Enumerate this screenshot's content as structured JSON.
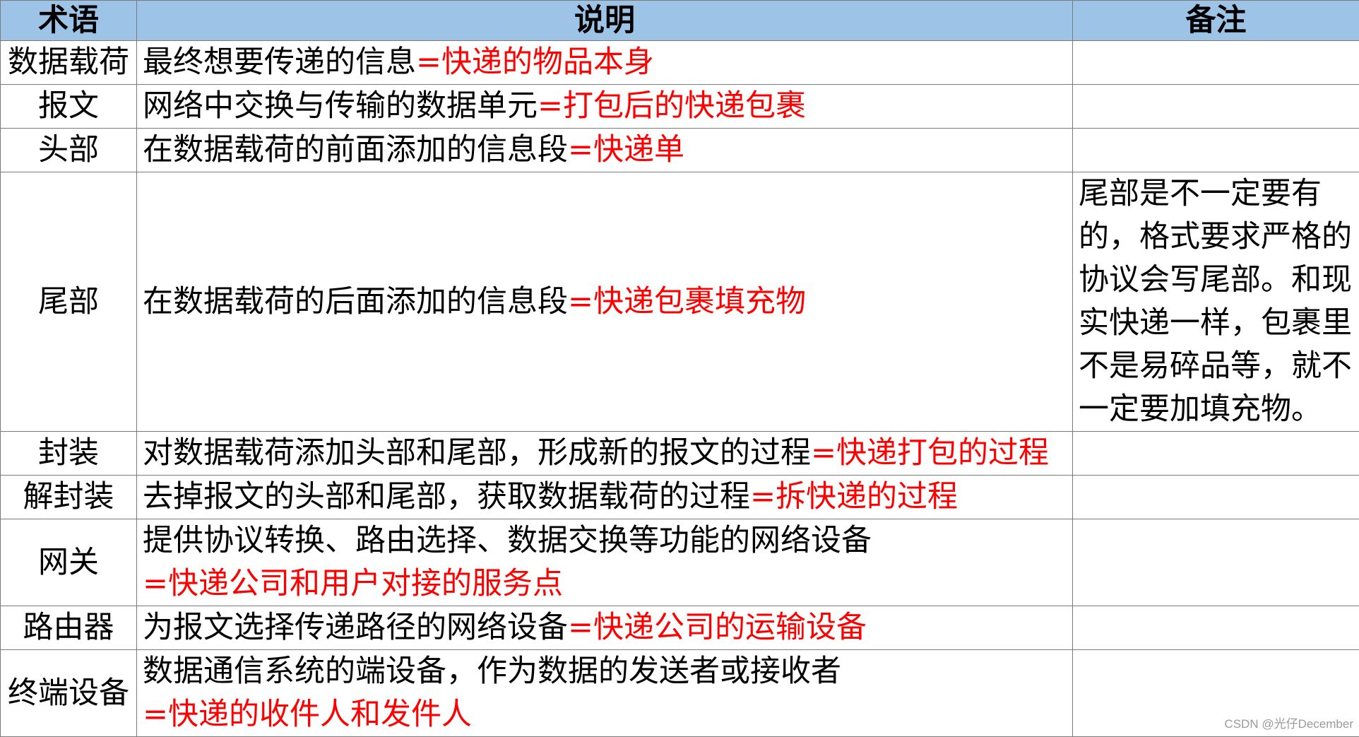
{
  "headers": {
    "term": "术语",
    "description": "说明",
    "note": "备注"
  },
  "rows": [
    {
      "term": "数据载荷",
      "description": [
        "最终想要传递的信息"
      ],
      "analogy": "=快递的物品本身",
      "analogy_new_line": false,
      "note": ""
    },
    {
      "term": "报文",
      "description": [
        "网络中交换与传输的数据单元"
      ],
      "analogy": "=打包后的快递包裹",
      "analogy_new_line": false,
      "note": ""
    },
    {
      "term": "头部",
      "description": [
        "在数据载荷的前面添加的信息段"
      ],
      "analogy": "=快递单",
      "analogy_new_line": false,
      "note": ""
    },
    {
      "term": "尾部",
      "description": [
        "在数据载荷的后面添加的信息段"
      ],
      "analogy": "=快递包裹填充物",
      "analogy_new_line": false,
      "note": "尾部是不一定要有的，格式要求严格的协议会写尾部。和现实快递一样，包裹里不是易碎品等，就不一定要加填充物。"
    },
    {
      "term": "封装",
      "description": [
        "对数据载荷添加头部和尾部，形成新的报文的过程"
      ],
      "analogy": "=快递打包的过程",
      "analogy_new_line": false,
      "note": ""
    },
    {
      "term": "解封装",
      "description": [
        "去掉报文的头部和尾部，获取数据载荷的过程"
      ],
      "analogy": "=拆快递的过程",
      "analogy_new_line": false,
      "note": ""
    },
    {
      "term": "网关",
      "description": [
        "提供协议转换、路由选择、数据交换等功能的网络设备"
      ],
      "analogy": "=快递公司和用户对接的服务点",
      "analogy_new_line": true,
      "note": ""
    },
    {
      "term": "路由器",
      "description": [
        "为报文选择传递路径的网络设备"
      ],
      "analogy": "=快递公司的运输设备",
      "analogy_new_line": false,
      "note": ""
    },
    {
      "term": "终端设备",
      "description": [
        "数据通信系统的端设备，作为数据的发送者或接收者"
      ],
      "analogy": "=快递的收件人和发件人",
      "analogy_new_line": true,
      "note": ""
    }
  ],
  "colors": {
    "header_background": "#9dc3e6",
    "analogy_text": "#ff0000",
    "border": "#7a7a7a"
  },
  "watermark": "CSDN @光仔December"
}
